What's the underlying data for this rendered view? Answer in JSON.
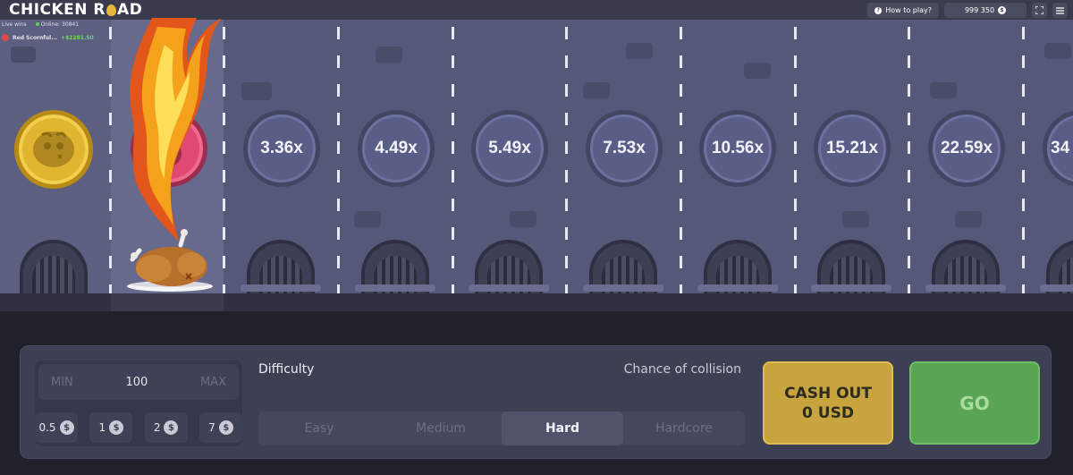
{
  "header": {
    "logo_left": "CHICKEN R",
    "logo_right": "AD",
    "how_to_play": "How to play?",
    "balance": "999 350",
    "balance_currency_symbol": "$"
  },
  "live_wins": {
    "label": "Live wins",
    "online": "Online: 30841",
    "entries": [
      {
        "name": "Red Scornful...",
        "amount": "+$2281.50"
      }
    ]
  },
  "lanes": {
    "multipliers": [
      "3.36x",
      "4.49x",
      "5.49x",
      "7.53x",
      "10.56x",
      "15.21x",
      "22.59x",
      "34"
    ]
  },
  "bet": {
    "min_label": "MIN",
    "value": "100",
    "max_label": "MAX",
    "chips": [
      {
        "label": "0.5"
      },
      {
        "label": "1"
      },
      {
        "label": "2"
      },
      {
        "label": "7"
      }
    ],
    "chip_symbol": "$"
  },
  "difficulty": {
    "label": "Difficulty",
    "chance_label": "Chance of collision",
    "options": [
      "Easy",
      "Medium",
      "Hard",
      "Hardcore"
    ],
    "selected": "Hard"
  },
  "actions": {
    "cashout_line1": "CASH OUT",
    "cashout_line2": "0 USD",
    "go": "GO"
  },
  "colors": {
    "accent_gold": "#c8a43f",
    "accent_green": "#5aa553",
    "hazard_red": "#e04a72"
  }
}
